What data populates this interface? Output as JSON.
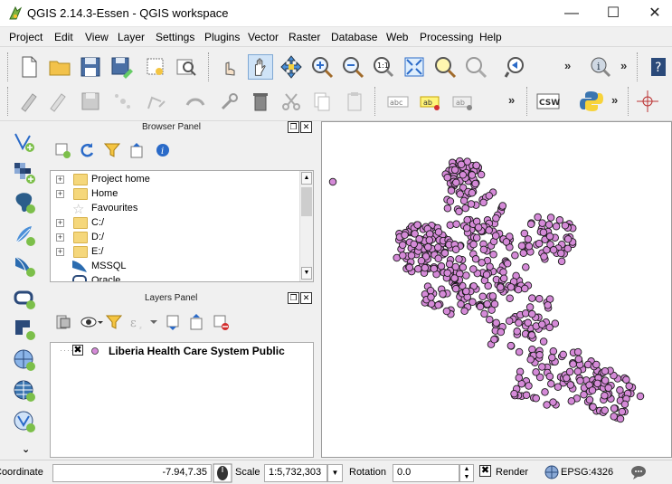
{
  "window": {
    "title": "QGIS 2.14.3-Essen - QGIS workspace"
  },
  "menu": [
    "Project",
    "Edit",
    "View",
    "Layer",
    "Settings",
    "Plugins",
    "Vector",
    "Raster",
    "Database",
    "Web",
    "Processing",
    "Help"
  ],
  "toolbar": {
    "more": "»",
    "csw_label": "CSW",
    "abc_label": "abc",
    "ab_label": "ab"
  },
  "browser_panel": {
    "title": "Browser Panel",
    "items": [
      {
        "label": "Project home",
        "icon": "folder-icon"
      },
      {
        "label": "Home",
        "icon": "folder-icon"
      },
      {
        "label": "Favourites",
        "icon": "star-icon"
      },
      {
        "label": "C:/",
        "icon": "folder-icon"
      },
      {
        "label": "D:/",
        "icon": "folder-icon"
      },
      {
        "label": "E:/",
        "icon": "folder-icon"
      },
      {
        "label": "MSSQL",
        "icon": "mssql-icon"
      },
      {
        "label": "Oracle",
        "icon": "oracle-icon"
      }
    ]
  },
  "layers_panel": {
    "title": "Layers Panel",
    "layers": [
      {
        "name": "Liberia Health Care System Public",
        "visible": true,
        "color": "#d58ad8"
      }
    ]
  },
  "status": {
    "coordinate_label": "Coordinate",
    "coordinate_value": "-7.94,7.35",
    "scale_label": "Scale",
    "scale_value": "1:5,732,303",
    "rotation_label": "Rotation",
    "rotation_value": "0.0",
    "render_label": "Render",
    "crs_label": "EPSG:4326"
  },
  "colors": {
    "point_fill": "#d58ad8",
    "point_stroke": "#1a1a1a",
    "accent": "#2b6cb0"
  }
}
